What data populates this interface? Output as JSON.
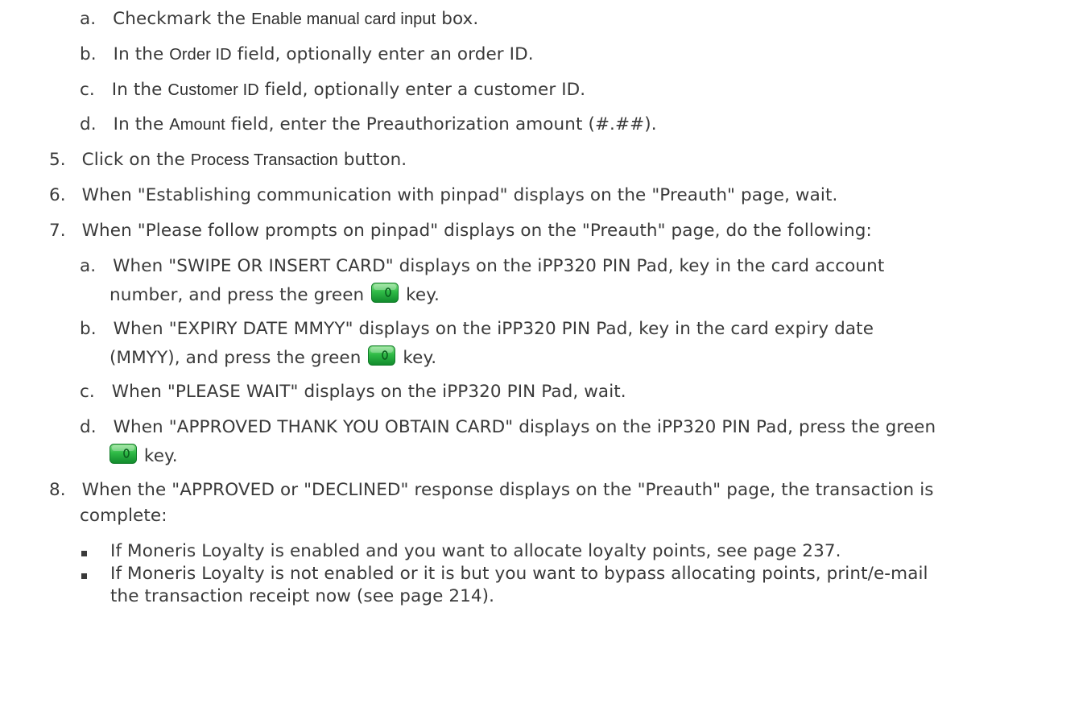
{
  "sub_steps_top": [
    {
      "marker": "a.",
      "before": "Checkmark the ",
      "term": "Enable manual card input",
      "after": " box."
    },
    {
      "marker": "b.",
      "before": "In the ",
      "term": "Order ID",
      "after": " field, optionally enter an order ID."
    },
    {
      "marker": "c.",
      "before": "In the ",
      "term": "Customer ID",
      "after": " field, optionally enter a customer ID."
    },
    {
      "marker": "d.",
      "before": "In the ",
      "term": "Amount",
      "after": " field, enter the Preauthorization amount (#.##)."
    }
  ],
  "steps": {
    "s5": {
      "marker": "5.",
      "before": "Click on the ",
      "term": "Process Transaction",
      "after": " button."
    },
    "s6": {
      "marker": "6.",
      "text": "When \"Establishing communication with pinpad\" displays on the \"Preauth\" page, wait."
    },
    "s7": {
      "marker": "7.",
      "text": "When \"Please follow prompts on pinpad\" displays on the \"Preauth\" page, do the following:"
    },
    "s8": {
      "marker": "8.",
      "line1": "When the \"APPROVED or \"DECLINED\" response displays on the \"Preauth\" page, the transaction is",
      "line2": "complete:"
    }
  },
  "sub_steps_7": {
    "a": {
      "marker": "a.",
      "line1": "When \"SWIPE OR INSERT CARD\" displays on the iPP320 PIN Pad, key in the card account",
      "line2_before": "number, and press the green ",
      "line2_after": " key."
    },
    "b": {
      "marker": "b.",
      "line1": "When \"EXPIRY DATE MMYY\" displays on the iPP320 PIN Pad, key in the card expiry date",
      "line2_before": "(MMYY), and press the green ",
      "line2_after": " key."
    },
    "c": {
      "marker": "c.",
      "text": "When \"PLEASE WAIT\" displays on the iPP320 PIN Pad, wait."
    },
    "d": {
      "marker": "d.",
      "line1": "When \"APPROVED THANK YOU OBTAIN CARD\" displays on the iPP320 PIN Pad, press the green",
      "line2_after": " key."
    }
  },
  "bullets": {
    "b1": "If Moneris Loyalty is enabled and you want to allocate loyalty points, see page 237.",
    "b2_line1": "If Moneris Loyalty is not enabled or it is but you want to bypass allocating points, print/e-mail",
    "b2_line2": "the transaction receipt now (see page 214)."
  },
  "icons": {
    "key_icon": "green-enter-key-icon",
    "key_color": "#22b24c"
  }
}
